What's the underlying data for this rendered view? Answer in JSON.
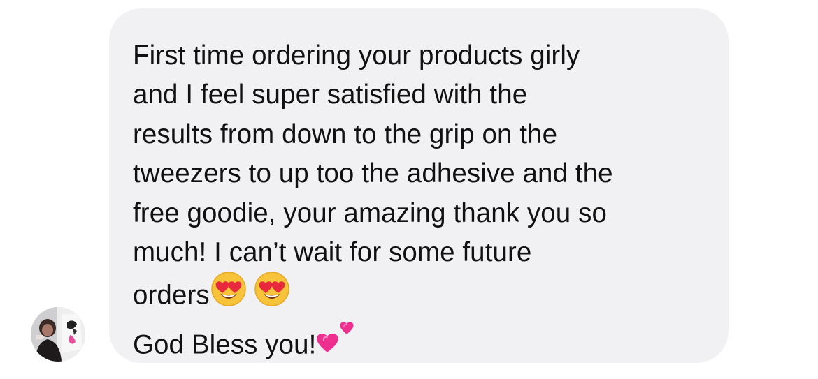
{
  "message": {
    "lines": [
      "First time ordering your products girly",
      "and I feel super satisfied with the",
      "results from down to the grip on the",
      "tweezers to up too the adhesive and the",
      "free goodie, your amazing thank you so",
      "much! I can’t wait for some future",
      "orders",
      "God Bless you!"
    ],
    "emojis": {
      "line7": [
        "heart-eyes-face",
        "heart-eyes-face"
      ],
      "line8": [
        "two-hearts"
      ]
    }
  },
  "colors": {
    "bubble_background": "#f1f1f4",
    "text": "#111111",
    "page_background": "#ffffff",
    "heart_pink": "#ee2f8f"
  }
}
